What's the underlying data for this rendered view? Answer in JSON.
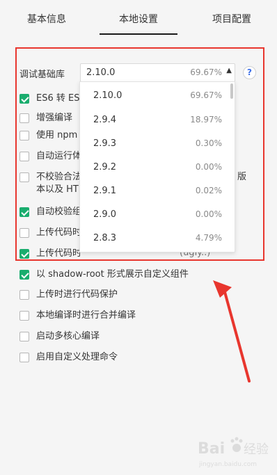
{
  "tabs": [
    {
      "label": "基本信息"
    },
    {
      "label": "本地设置"
    },
    {
      "label": "项目配置"
    }
  ],
  "library": {
    "label": "调试基础库",
    "selected_version": "2.10.0",
    "selected_percent": "69.67%",
    "help": "?"
  },
  "dropdown": {
    "options": [
      {
        "version": "2.10.0",
        "percent": "69.67%"
      },
      {
        "version": "2.9.4",
        "percent": "18.97%"
      },
      {
        "version": "2.9.3",
        "percent": "0.30%"
      },
      {
        "version": "2.9.2",
        "percent": "0.00%"
      },
      {
        "version": "2.9.1",
        "percent": "0.02%"
      },
      {
        "version": "2.9.0",
        "percent": "0.00%"
      },
      {
        "version": "2.8.3",
        "percent": "4.79%"
      }
    ]
  },
  "settings": [
    {
      "label": "ES6 转 ES",
      "checked": true
    },
    {
      "label": "增强编译",
      "checked": false
    },
    {
      "label": "使用 npm 模",
      "checked": false
    },
    {
      "label": "自动运行体",
      "checked": false
    },
    {
      "label": "不校验合法",
      "label_line2": "本以及 HT",
      "checked": false
    },
    {
      "label": "自动校验组",
      "checked": true
    },
    {
      "label": "上传代码时",
      "checked": false
    },
    {
      "label": "上传代码时",
      "checked": true
    },
    {
      "label": "以 shadow-root 形式展示自定义组件",
      "checked": true
    },
    {
      "label": "上传时进行代码保护",
      "checked": false
    },
    {
      "label": "本地编译时进行合并编译",
      "checked": false
    },
    {
      "label": "启动多核心编译",
      "checked": false
    },
    {
      "label": "启用自定义处理命令",
      "checked": false
    }
  ],
  "partial_texts": {
    "row5_tail": "版",
    "row8_tail": "(ugly..)"
  },
  "watermark": {
    "brand": "Baidu",
    "sub": "jingyan.baidu.com"
  },
  "colors": {
    "accent_green": "#1aad6e",
    "highlight_red": "#e8362e",
    "help_blue": "#3b6ee8"
  }
}
